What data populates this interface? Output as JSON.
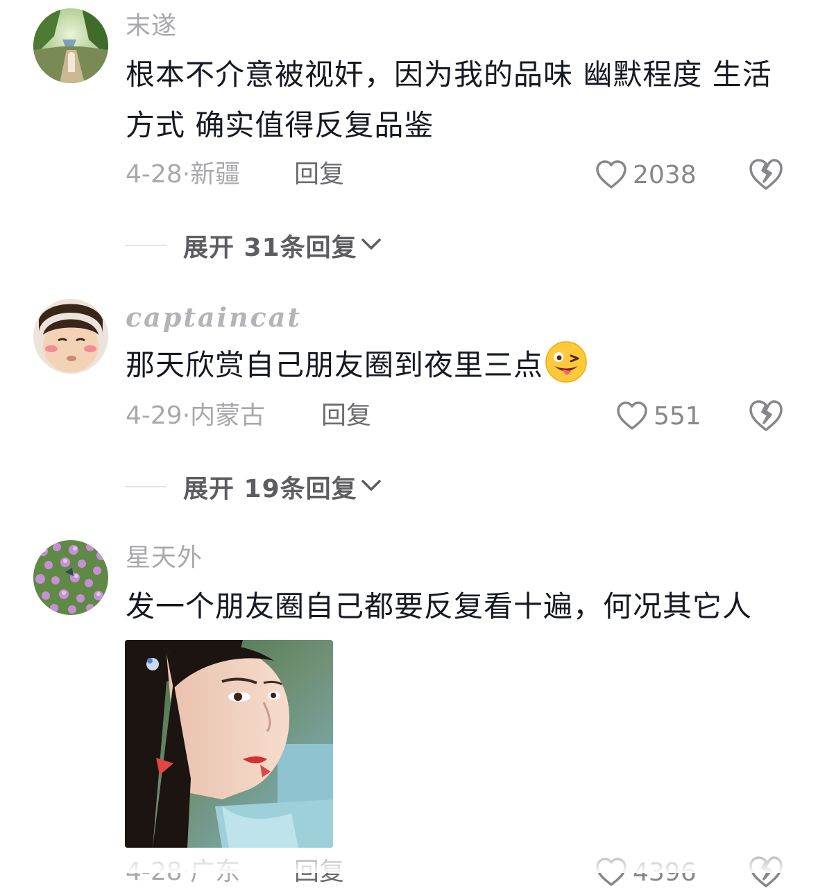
{
  "comments": [
    {
      "username": "末遂",
      "text": "根本不介意被视奸，因为我的品味 幽默程度 生活方式 确实值得反复品鉴",
      "date": "4-28",
      "location": "新疆",
      "reply_label": "回复",
      "likes": "2038",
      "expand_label": "展开 31条回复"
    },
    {
      "username": "captaincat",
      "text": "那天欣赏自己朋友圈到夜里三点",
      "emoji": "😜",
      "date": "4-29",
      "location": "内蒙古",
      "reply_label": "回复",
      "likes": "551",
      "expand_label": "展开 19条回复"
    },
    {
      "username": "星天外",
      "text": "发一个朋友圈自己都要反复看十遍，何况其它人",
      "date": "4-28",
      "location": "广东",
      "reply_label": "回复",
      "likes": "4396"
    }
  ],
  "icons": {
    "like": "heart-outline-icon",
    "dislike": "broken-heart-icon",
    "expand": "chevron-down-icon"
  },
  "colors": {
    "text": "#161823",
    "meta": "#a8a8ad",
    "reply": "#6b6b70",
    "expand": "#5c5c61"
  }
}
